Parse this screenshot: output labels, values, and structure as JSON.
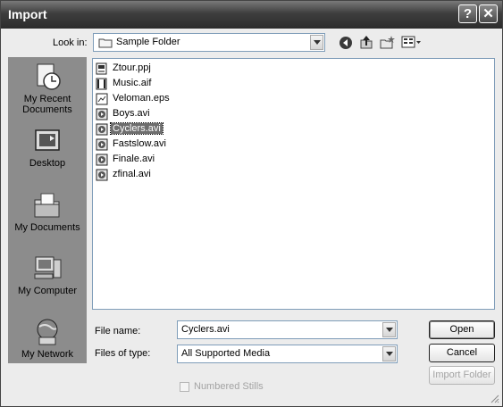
{
  "window": {
    "title": "Import"
  },
  "titlebar": {
    "help_glyph": "?",
    "close_glyph": "✕"
  },
  "lookin": {
    "label": "Look in:",
    "value": "Sample Folder"
  },
  "places": [
    {
      "label_line1": "My Recent",
      "label_line2": "Documents",
      "icon": "recent-documents-icon"
    },
    {
      "label_line1": "Desktop",
      "label_line2": "",
      "icon": "desktop-icon"
    },
    {
      "label_line1": "My Documents",
      "label_line2": "",
      "icon": "my-documents-icon"
    },
    {
      "label_line1": "My Computer",
      "label_line2": "",
      "icon": "my-computer-icon"
    },
    {
      "label_line1": "My Network",
      "label_line2": "",
      "icon": "my-network-icon"
    }
  ],
  "files": [
    {
      "name": "Ztour.ppj",
      "icon": "project-file-icon",
      "selected": false
    },
    {
      "name": "Music.aif",
      "icon": "audio-file-icon",
      "selected": false
    },
    {
      "name": "Veloman.eps",
      "icon": "image-file-icon",
      "selected": false
    },
    {
      "name": "Boys.avi",
      "icon": "video-file-icon",
      "selected": false
    },
    {
      "name": "Cyclers.avi",
      "icon": "video-file-icon",
      "selected": true
    },
    {
      "name": "Fastslow.avi",
      "icon": "video-file-icon",
      "selected": false
    },
    {
      "name": "Finale.avi",
      "icon": "video-file-icon",
      "selected": false
    },
    {
      "name": "zfinal.avi",
      "icon": "video-file-icon",
      "selected": false
    }
  ],
  "filename": {
    "label": "File name:",
    "value": "Cyclers.avi"
  },
  "filetype": {
    "label": "Files of type:",
    "value": "All Supported Media"
  },
  "buttons": {
    "open": "Open",
    "cancel": "Cancel",
    "import_folder": "Import Folder"
  },
  "numbered_stills": {
    "label": "Numbered Stills",
    "checked": false,
    "enabled": false
  }
}
